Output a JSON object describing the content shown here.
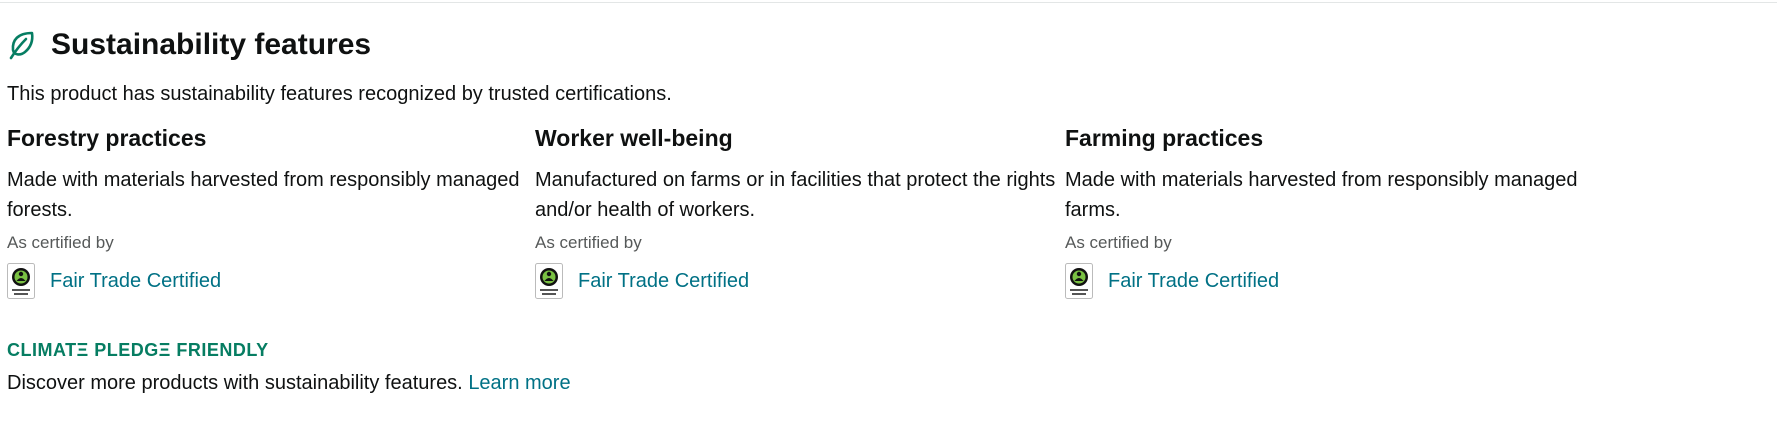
{
  "header": {
    "title": "Sustainability features",
    "icon": "leaf-icon"
  },
  "intro": "This product has sustainability features recognized by trusted certifications.",
  "features": [
    {
      "title": "Forestry practices",
      "description": "Made with materials harvested from responsibly managed forests.",
      "cert_label": "As certified by",
      "cert_link": "Fair Trade Certified",
      "cert_icon": "fair-trade-badge-icon"
    },
    {
      "title": "Worker well-being",
      "description": "Manufactured on farms or in facilities that protect the rights and/or health of workers.",
      "cert_label": "As certified by",
      "cert_link": "Fair Trade Certified",
      "cert_icon": "fair-trade-badge-icon"
    },
    {
      "title": "Farming practices",
      "description": "Made with materials harvested from responsibly managed farms.",
      "cert_label": "As certified by",
      "cert_link": "Fair Trade Certified",
      "cert_icon": "fair-trade-badge-icon"
    }
  ],
  "climate_pledge": {
    "logo_text": "CLIMATΞ PLEDGΞ FRIENDLY",
    "discover_text": "Discover more products with sustainability features.",
    "learn_more": "Learn more"
  },
  "colors": {
    "brand_green": "#067d62",
    "link": "#007185",
    "text": "#0f1111",
    "muted": "#565959"
  }
}
